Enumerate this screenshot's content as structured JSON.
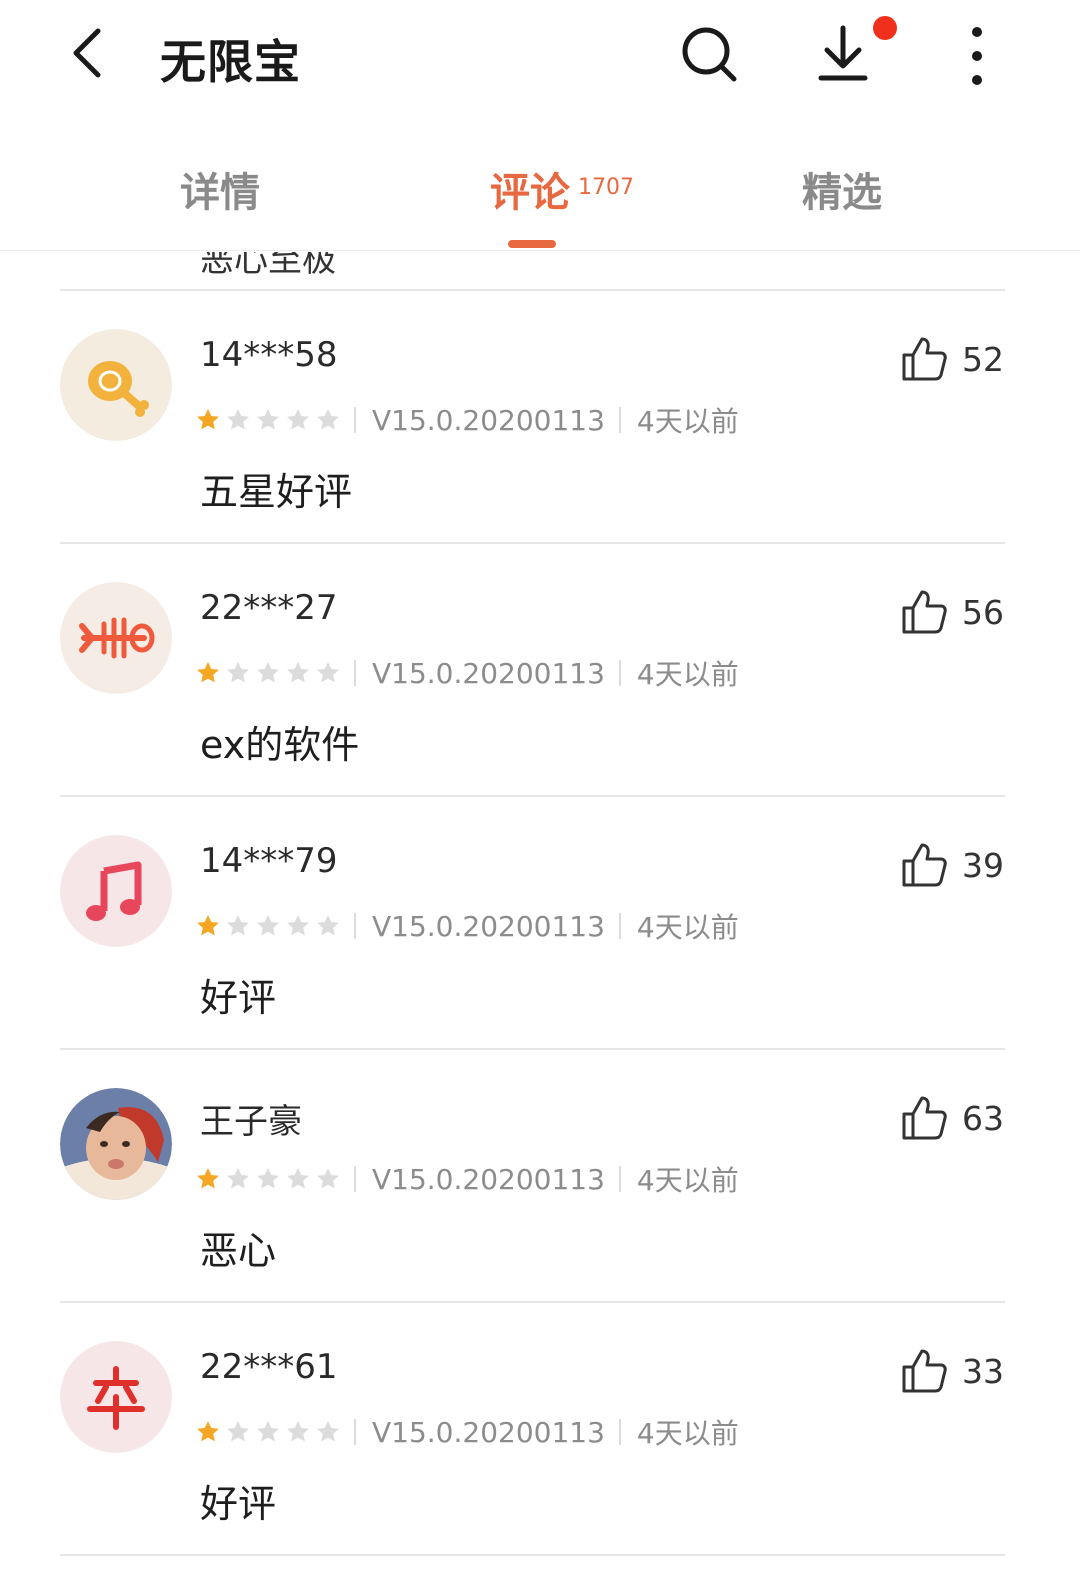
{
  "header": {
    "title": "无限宝",
    "has_download_badge": true,
    "accent_color": "#e8683f",
    "badge_color": "#f0301c"
  },
  "tabs": [
    {
      "label": "详情",
      "count": ""
    },
    {
      "label": "评论",
      "count": "1707"
    },
    {
      "label": "精选",
      "count": ""
    }
  ],
  "active_tab": 1,
  "peek_text": "恶心至极",
  "reviews": [
    {
      "user": "14***58",
      "rating": 1,
      "max_rating": 5,
      "version": "V15.0.20200113",
      "time": "4天以前",
      "content": "五星好评",
      "likes": "52",
      "avatar_icon": "drumstick-icon",
      "avatar_color": "#f3ecdf"
    },
    {
      "user": "22***27",
      "rating": 1,
      "max_rating": 5,
      "version": "V15.0.20200113",
      "time": "4天以前",
      "content": "ex的软件",
      "likes": "56",
      "avatar_icon": "fishbone-icon",
      "avatar_color": "#f6ece6"
    },
    {
      "user": "14***79",
      "rating": 1,
      "max_rating": 5,
      "version": "V15.0.20200113",
      "time": "4天以前",
      "content": "好评",
      "likes": "39",
      "avatar_icon": "music-note-icon",
      "avatar_color": "#f6e6e8"
    },
    {
      "user": "王子豪",
      "rating": 1,
      "max_rating": 5,
      "version": "V15.0.20200113",
      "time": "4天以前",
      "content": "恶心",
      "likes": "63",
      "avatar_icon": "photo-avatar",
      "avatar_color": "#6b7fa8"
    },
    {
      "user": "22***61",
      "rating": 1,
      "max_rating": 5,
      "version": "V15.0.20200113",
      "time": "4天以前",
      "content": "好评",
      "likes": "33",
      "avatar_icon": "chess-pawn-icon",
      "avatar_color": "#f6e6e8"
    }
  ]
}
